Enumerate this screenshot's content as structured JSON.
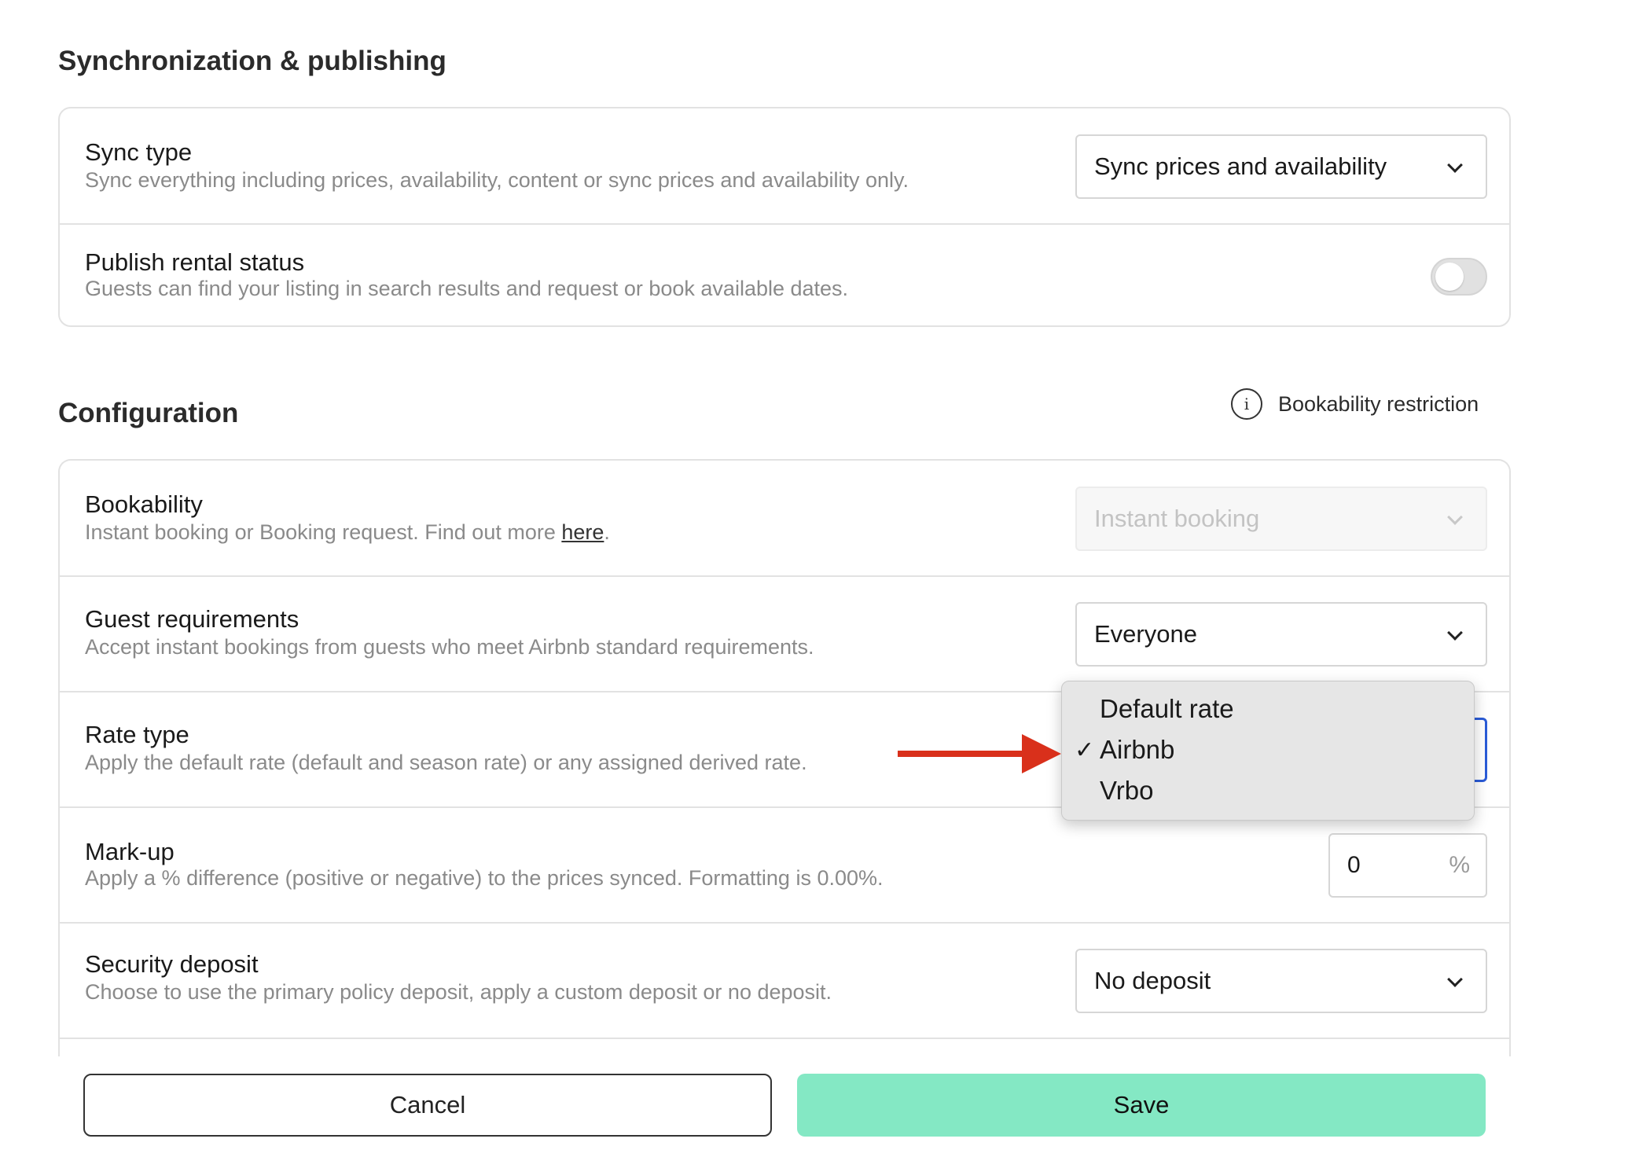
{
  "sync_section": {
    "title": "Synchronization & publishing",
    "sync_type": {
      "title": "Sync type",
      "description": "Sync everything including prices, availability, content or sync prices and availability only.",
      "selected": "Sync prices and availability"
    },
    "publish_status": {
      "title": "Publish rental status",
      "description": "Guests can find your listing in search results and request or book available dates.",
      "enabled": false
    }
  },
  "config_section": {
    "title": "Configuration",
    "info_link": "Bookability restriction",
    "bookability": {
      "title": "Bookability",
      "description": "Instant booking or Booking request. Find out more ",
      "link_text": "here",
      "suffix": ".",
      "selected": "Instant booking",
      "disabled": true
    },
    "guest_requirements": {
      "title": "Guest requirements",
      "description": "Accept instant bookings from guests who meet Airbnb standard requirements.",
      "selected": "Everyone"
    },
    "rate_type": {
      "title": "Rate type",
      "description": "Apply the default rate (default and season rate) or any assigned derived rate.",
      "options": [
        "Default rate",
        "Airbnb",
        "Vrbo"
      ],
      "selected": "Airbnb",
      "check_mark": "✓"
    },
    "markup": {
      "title": "Mark-up",
      "description": "Apply a % difference (positive or negative) to the prices synced. Formatting is 0.00%.",
      "value": "0",
      "unit": "%"
    },
    "security_deposit": {
      "title": "Security deposit",
      "description": "Choose to use the primary policy deposit, apply a custom deposit or no deposit.",
      "selected": "No deposit"
    }
  },
  "actions": {
    "cancel": "Cancel",
    "save": "Save"
  },
  "colors": {
    "save_bg": "#84e8c4",
    "arrow": "#d9301b",
    "focus": "#2a5bd7"
  }
}
